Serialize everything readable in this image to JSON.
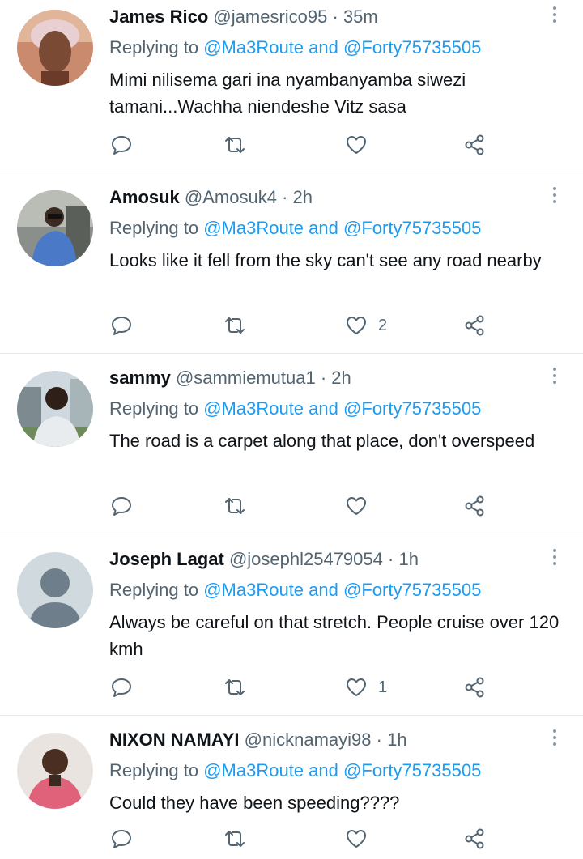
{
  "replying_label": "Replying to",
  "mention1": "@Ma3Route",
  "and_label": "and",
  "mention2": "@Forty75735505",
  "dot": "·",
  "tweets": [
    {
      "name": "James Rico",
      "handle": "@jamesrico95",
      "time": "35m",
      "text": "Mimi nilisema gari ina nyambanyamba siwezi tamani...Wachha niendeshe Vitz sasa",
      "likes": ""
    },
    {
      "name": "Amosuk",
      "handle": "@Amosuk4",
      "time": "2h",
      "text": "Looks like it fell from the sky can't see any road nearby",
      "likes": "2"
    },
    {
      "name": "sammy",
      "handle": "@sammiemutua1",
      "time": "2h",
      "text": "The road is a carpet along that place, don't overspeed",
      "likes": ""
    },
    {
      "name": "Joseph Lagat",
      "handle": "@josephl25479054",
      "time": "1h",
      "text": "Always be careful on that stretch. People cruise over 120 kmh",
      "likes": "1"
    },
    {
      "name": "NIXON NAMAYI",
      "handle": "@nicknamayi98",
      "time": "1h",
      "text": "Could they have been speeding????",
      "likes": ""
    }
  ]
}
